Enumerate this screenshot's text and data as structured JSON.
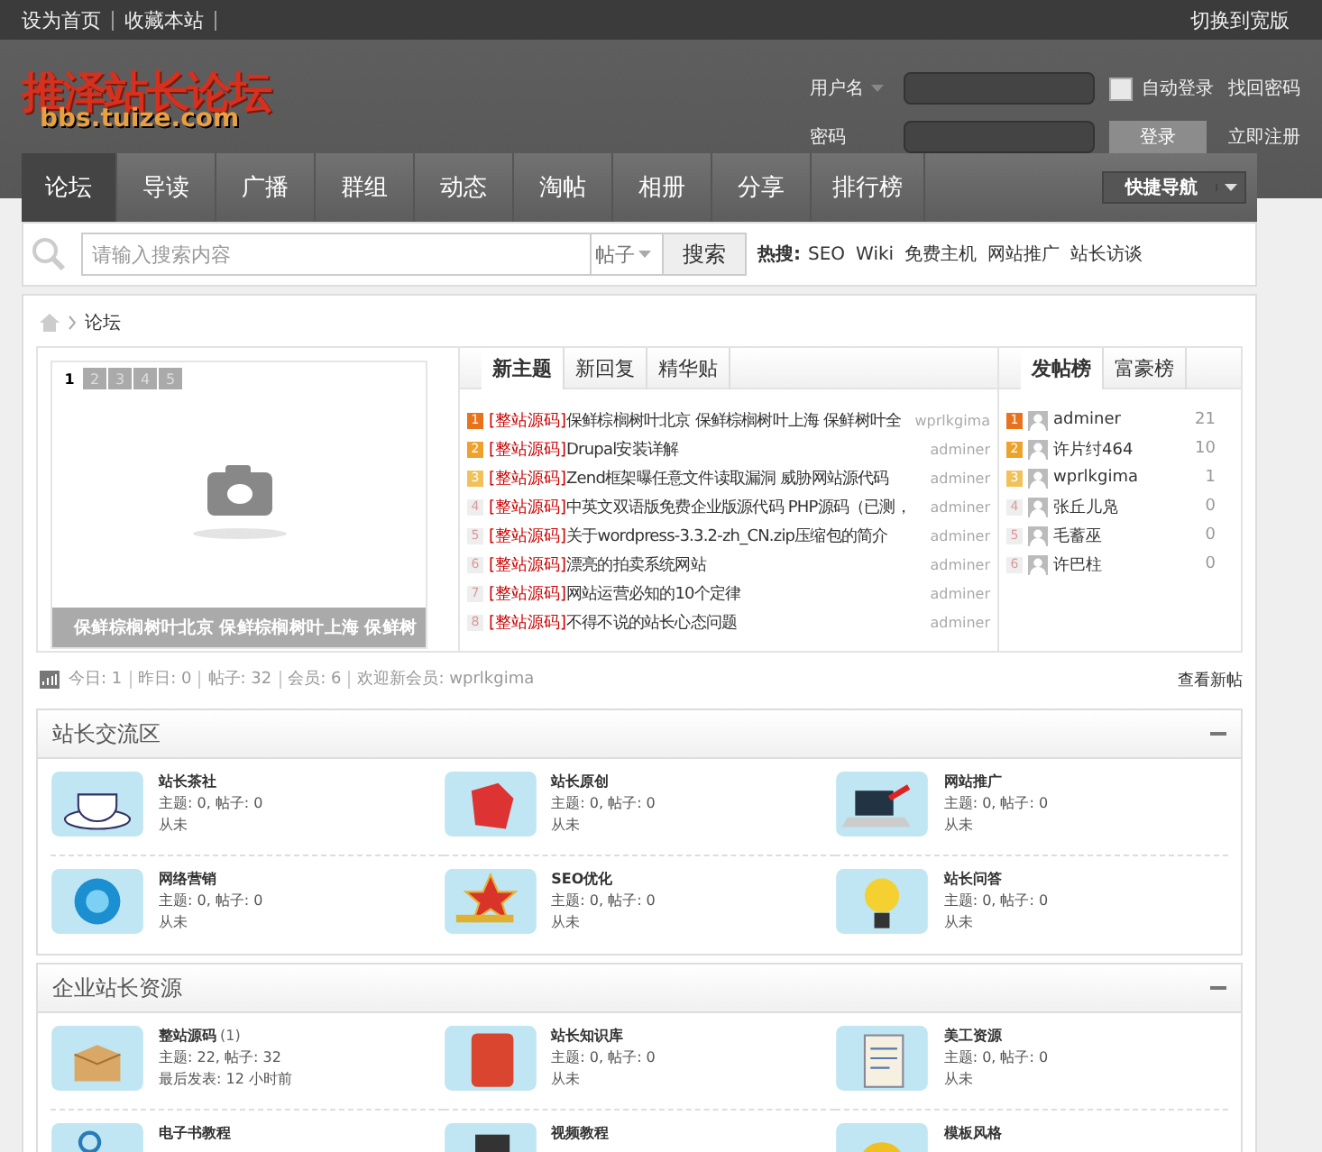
{
  "top_links": [
    "设为首页",
    "收藏本站"
  ],
  "top_right": "切换到宽版",
  "logo": {
    "title": "推泽站长论坛",
    "subtitle": "bbs.tuize.com"
  },
  "login": {
    "username_label": "用户名",
    "password_label": "密码",
    "auto_login": {
      "label": "自动登录",
      "checked": false
    },
    "forgot": "找回密码",
    "login_button": "登录",
    "register": "立即注册"
  },
  "nav": [
    {
      "label": "论坛",
      "selected": true
    },
    {
      "label": "导读",
      "selected": false
    },
    {
      "label": "广播",
      "selected": false
    },
    {
      "label": "群组",
      "selected": false
    },
    {
      "label": "动态",
      "selected": false
    },
    {
      "label": "淘帖",
      "selected": false
    },
    {
      "label": "相册",
      "selected": false
    },
    {
      "label": "分享",
      "selected": false
    },
    {
      "label": "排行榜",
      "selected": false
    }
  ],
  "quick_nav": "快捷导航",
  "search": {
    "placeholder": "请输入搜索内容",
    "scope": "帖子",
    "button": "搜索",
    "hot_label": "热搜:",
    "hot": [
      "SEO",
      "Wiki",
      "免费主机",
      "网站推广",
      "站长访谈"
    ]
  },
  "breadcrumb": "论坛",
  "slideshow": {
    "pages": [
      {
        "label": "1",
        "selected": true
      },
      {
        "label": "2",
        "selected": false
      },
      {
        "label": "3",
        "selected": false
      },
      {
        "label": "4",
        "selected": false
      },
      {
        "label": "5",
        "selected": false
      }
    ],
    "caption": "保鲜棕榈树叶北京 保鲜棕榈树叶上海 保鲜树"
  },
  "topic_tabs": [
    {
      "label": "新主题",
      "selected": true
    },
    {
      "label": "新回复",
      "selected": false
    },
    {
      "label": "精华贴",
      "selected": false
    }
  ],
  "topics": [
    {
      "rank": "1",
      "color": "#e8731d",
      "tag": "[整站源码]",
      "title": "保鲜棕榈树叶北京 保鲜棕榈树叶上海 保鲜树叶全",
      "author": "wprlkgima"
    },
    {
      "rank": "2",
      "color": "#eda22c",
      "tag": "[整站源码]",
      "title": "Drupal安装详解",
      "author": "adminer"
    },
    {
      "rank": "3",
      "color": "#f2c25a",
      "tag": "[整站源码]",
      "title": "Zend框架曝任意文件读取漏洞 威胁网站源代码",
      "author": "adminer"
    },
    {
      "rank": "4",
      "color": "#eeeeee",
      "tag": "[整站源码]",
      "title": "中英文双语版免费企业版源代码 PHP源码（已测，",
      "author": "adminer"
    },
    {
      "rank": "5",
      "color": "#eeeeee",
      "tag": "[整站源码]",
      "title": "关于wordpress-3.3.2-zh_CN.zip压缩包的简介",
      "author": "adminer"
    },
    {
      "rank": "6",
      "color": "#eeeeee",
      "tag": "[整站源码]",
      "title": "漂亮的拍卖系统网站",
      "author": "adminer"
    },
    {
      "rank": "7",
      "color": "#eeeeee",
      "tag": "[整站源码]",
      "title": "网站运营必知的10个定律",
      "author": "adminer"
    },
    {
      "rank": "8",
      "color": "#eeeeee",
      "tag": "[整站源码]",
      "title": "不得不说的站长心态问题",
      "author": "adminer"
    }
  ],
  "rank_tabs": [
    {
      "label": "发帖榜",
      "selected": true
    },
    {
      "label": "富豪榜",
      "selected": false
    }
  ],
  "ranking": [
    {
      "rank": "1",
      "color": "#e8731d",
      "name": "adminer",
      "count": "21"
    },
    {
      "rank": "2",
      "color": "#eda22c",
      "name": "许片纣464",
      "count": "10"
    },
    {
      "rank": "3",
      "color": "#f2c25a",
      "name": "wprlkgima",
      "count": "1"
    },
    {
      "rank": "4",
      "color": "#eeeeee",
      "name": "张丘儿凫",
      "count": "0"
    },
    {
      "rank": "5",
      "color": "#eeeeee",
      "name": "毛蓄巫",
      "count": "0"
    },
    {
      "rank": "6",
      "color": "#eeeeee",
      "name": "许巴柱",
      "count": "0"
    }
  ],
  "stats": {
    "items": [
      "今日: 1",
      "昨日: 0",
      "帖子: 32",
      "会员: 6",
      "欢迎新会员: wprlkgima"
    ],
    "new_posts": "查看新帖"
  },
  "sections": [
    {
      "title": "站长交流区",
      "forums": [
        {
          "name": "站长茶社",
          "stats": "主题: 0, 帖子: 0",
          "last": "从未"
        },
        {
          "name": "站长原创",
          "stats": "主题: 0, 帖子: 0",
          "last": "从未"
        },
        {
          "name": "网站推广",
          "stats": "主题: 0, 帖子: 0",
          "last": "从未"
        },
        {
          "name": "网络营销",
          "stats": "主题: 0, 帖子: 0",
          "last": "从未"
        },
        {
          "name": "SEO优化",
          "stats": "主题: 0, 帖子: 0",
          "last": "从未"
        },
        {
          "name": "站长问答",
          "stats": "主题: 0, 帖子: 0",
          "last": "从未"
        }
      ]
    },
    {
      "title": "企业站长资源",
      "forums": [
        {
          "name": "整站源码",
          "count": "(1)",
          "stats": "主题: 22, 帖子: 32",
          "last": "最后发表: 12 小时前"
        },
        {
          "name": "站长知识库",
          "stats": "主题: 0, 帖子: 0",
          "last": "从未"
        },
        {
          "name": "美工资源",
          "stats": "主题: 0, 帖子: 0",
          "last": "从未"
        },
        {
          "name": "电子书教程"
        },
        {
          "name": "视频教程"
        },
        {
          "name": "模板风格"
        }
      ]
    }
  ]
}
